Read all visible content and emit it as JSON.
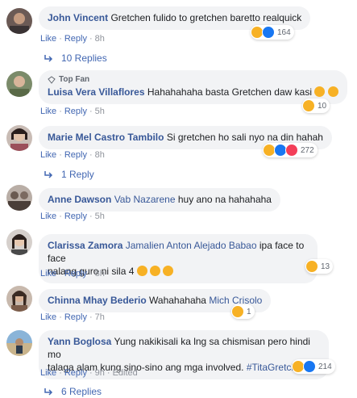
{
  "comments": [
    {
      "name": "John Vincent",
      "text": "Gretchen fulido to gretchen baretto realquick",
      "like": "Like",
      "reply": "Reply",
      "time": "8h",
      "reaction_count": "164",
      "replies_label": "10 Replies"
    },
    {
      "badge": "Top Fan",
      "name": "Luisa Vera Villaflores",
      "text": "Hahahahaha basta Gretchen daw kasi",
      "like": "Like",
      "reply": "Reply",
      "time": "5h",
      "reaction_count": "10"
    },
    {
      "name": "Marie Mel Castro Tambilo",
      "text": "Si gretchen ho sali nyo na din hahah",
      "like": "Like",
      "reply": "Reply",
      "time": "8h",
      "reaction_count": "272",
      "replies_label": "1 Reply"
    },
    {
      "name": "Anne Dawson",
      "tag": "Vab Nazarene",
      "text": "huy ano na hahahaha",
      "like": "Like",
      "reply": "Reply",
      "time": "5h"
    },
    {
      "name": "Clarissa Zamora",
      "tag": "Jamalien Anton Alejado Babao",
      "text_line1": "ipa face to face",
      "text_line2": "nalang guro ni sila 4",
      "like": "Like",
      "reply": "Reply",
      "time": "8h",
      "reaction_count": "13"
    },
    {
      "name": "Chinna Mhay Bederio",
      "text": "Wahahahaha",
      "tag": "Mich Crisolo",
      "like": "Like",
      "reply": "Reply",
      "time": "7h",
      "reaction_count": "1"
    },
    {
      "name": "Yann Boglosa",
      "text_line1": "Yung nakikisali ka lng sa chismisan pero hindi mo",
      "text_line2": "talaga alam kung sino-sino ang mga involved.",
      "hashtag": "#TitaGretchen",
      "like": "Like",
      "reply": "Reply",
      "time": "9h",
      "edited": "Edited",
      "reaction_count": "214",
      "replies_label": "6 Replies"
    }
  ],
  "colors": {
    "link": "#385898",
    "action_link": "#4267b2",
    "bubble": "#f2f3f5",
    "haha": "#f7b125",
    "like": "#1877f2",
    "love": "#f33e58"
  },
  "icons": [
    "haha-icon",
    "like-icon",
    "love-icon",
    "reply-arrow-icon",
    "top-fan-icon"
  ]
}
